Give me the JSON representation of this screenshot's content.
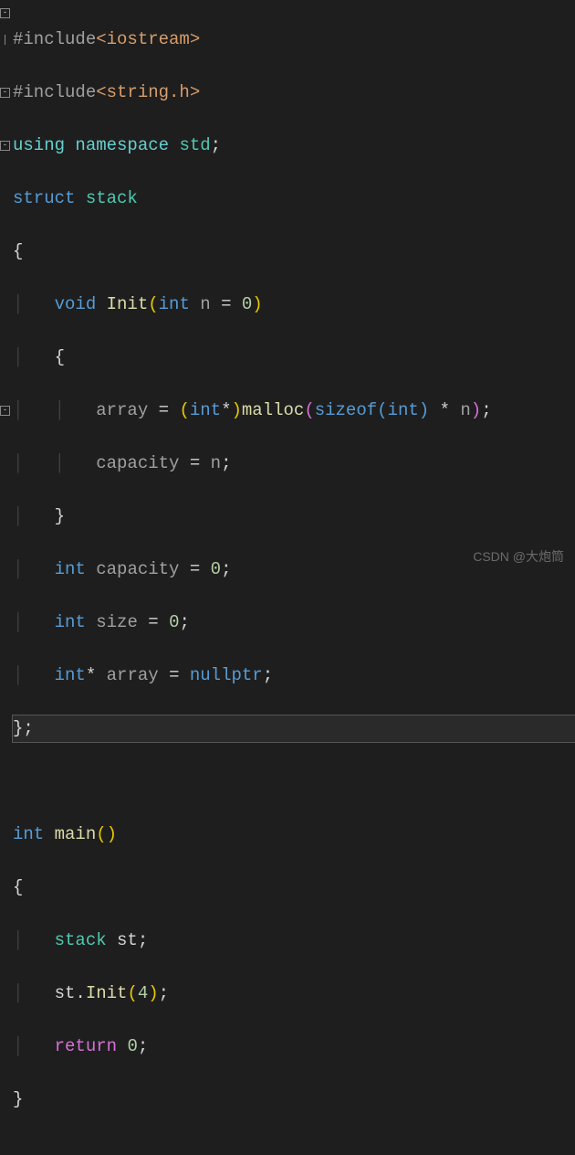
{
  "gutter_markers": [
    {
      "line": 0,
      "symbol": "-"
    },
    {
      "line": 1,
      "symbol": ""
    },
    {
      "line": 3,
      "symbol": "-"
    },
    {
      "line": 5,
      "symbol": "-"
    },
    {
      "line": 15,
      "symbol": "-"
    }
  ],
  "code": {
    "l0": {
      "pp": "#include",
      "hdr": "<iostream>"
    },
    "l1": {
      "pp": "#include",
      "hdr": "<string.h>"
    },
    "l2": {
      "kw_using": "using",
      "kw_ns": "namespace",
      "type": "std",
      "semi": ";"
    },
    "l3": {
      "kw": "struct",
      "type": "stack"
    },
    "l4": {
      "brace": "{"
    },
    "l5": {
      "kw": "void",
      "fn": "Init",
      "lp": "(",
      "kw2": "int",
      "id": "n",
      "eq": "=",
      "num": "0",
      "rp": ")"
    },
    "l6": {
      "brace": "{"
    },
    "l7": {
      "id": "array",
      "eq": "=",
      "lp": "(",
      "kw": "int",
      "star": "*",
      "rp": ")",
      "fn": "malloc",
      "lp2": "(",
      "siz": "sizeof",
      "lp3": "(",
      "kw2": "int",
      "rp3": ")",
      "mul": "*",
      "id2": "n",
      "rp2": ")",
      "semi": ";"
    },
    "l8": {
      "id": "capacity",
      "eq": "=",
      "id2": "n",
      "semi": ";"
    },
    "l9": {
      "brace": "}"
    },
    "l10": {
      "kw": "int",
      "id": "capacity",
      "eq": "=",
      "num": "0",
      "semi": ";"
    },
    "l11": {
      "kw": "int",
      "id": "size",
      "eq": "=",
      "num": "0",
      "semi": ";"
    },
    "l12": {
      "kw": "int",
      "star": "*",
      "id": "array",
      "eq": "=",
      "null": "nullptr",
      "semi": ";"
    },
    "l13": {
      "brace": "}",
      "semi": ";"
    },
    "l15": {
      "kw": "int",
      "fn": "main",
      "lp": "(",
      "rp": ")"
    },
    "l16": {
      "brace": "{"
    },
    "l17": {
      "type": "stack",
      "id": "st",
      "semi": ";"
    },
    "l18": {
      "id": "st",
      "dot": ".",
      "fn": "Init",
      "lp": "(",
      "num": "4",
      "rp": ")",
      "semi": ";"
    },
    "l19": {
      "kw": "return",
      "num": "0",
      "semi": ";"
    },
    "l20": {
      "brace": "}"
    }
  },
  "watermark": "CSDN @大炮筒"
}
